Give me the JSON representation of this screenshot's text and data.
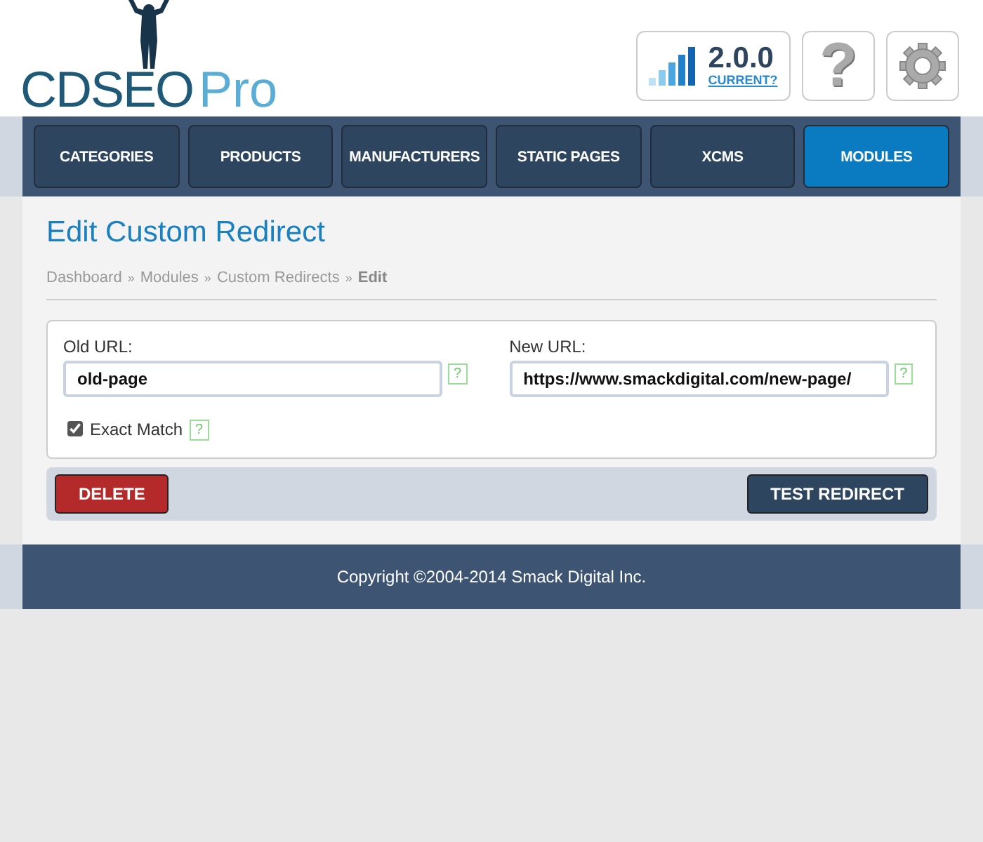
{
  "logo": {
    "name": "CDSEO",
    "suffix": "Pro"
  },
  "version": {
    "number": "2.0.0",
    "link": "CURRENT?"
  },
  "help": {
    "label": "?"
  },
  "nav": [
    {
      "label": "CATEGORIES",
      "selected": false
    },
    {
      "label": "PRODUCTS",
      "selected": false
    },
    {
      "label": "MANUFACTURERS",
      "selected": false
    },
    {
      "label": "STATIC PAGES",
      "selected": false
    },
    {
      "label": "XCMS",
      "selected": false
    },
    {
      "label": "MODULES",
      "selected": true
    }
  ],
  "page_title": "Edit Custom Redirect",
  "breadcrumbs": [
    {
      "label": "Dashboard",
      "current": false
    },
    {
      "label": "Modules",
      "current": false
    },
    {
      "label": "Custom Redirects",
      "current": false
    },
    {
      "label": "Edit",
      "current": true
    }
  ],
  "breadcrumb_separator": "»",
  "fields": [
    {
      "label": "Old URL:",
      "value": "old-page",
      "help": "?"
    },
    {
      "label": "New URL:",
      "value": "https://www.smackdigital.com/new-page/",
      "help": "?"
    }
  ],
  "exact_match": {
    "label": "Exact Match",
    "checked": true,
    "help": "?"
  },
  "buttons": [
    {
      "label": "DELETE",
      "kind": "danger"
    },
    {
      "label": "TEST REDIRECT",
      "kind": "primary"
    }
  ],
  "footer": "Copyright ©2004-2014 Smack Digital Inc."
}
